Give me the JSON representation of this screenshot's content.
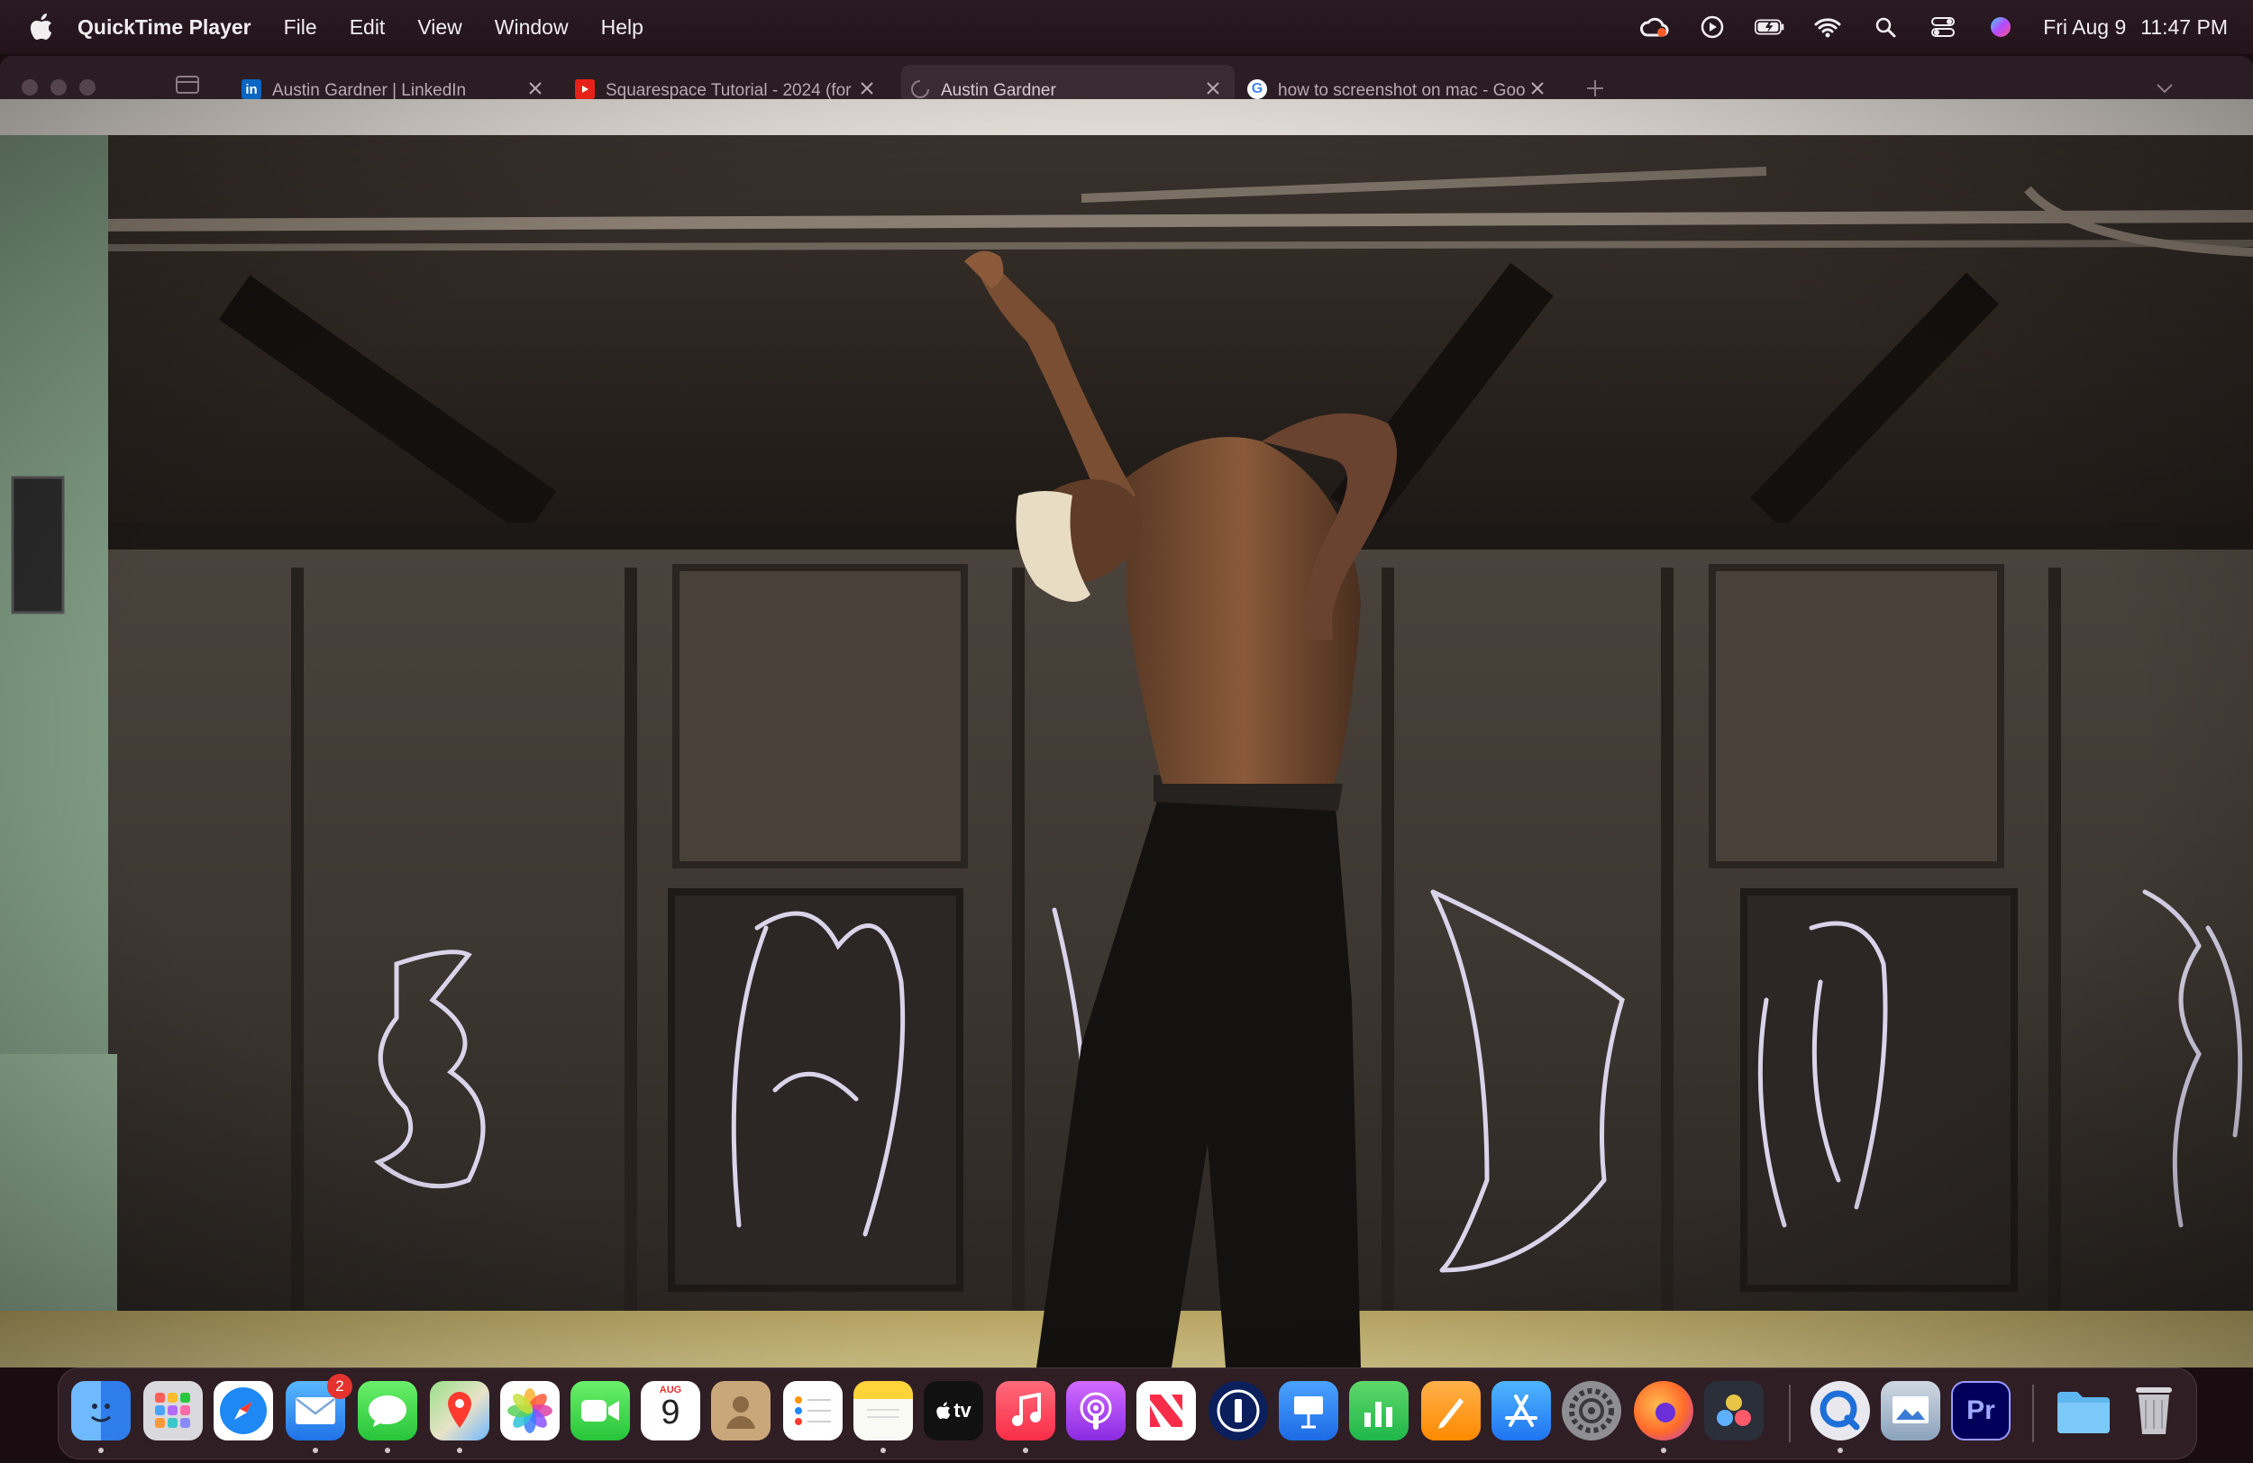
{
  "menubar": {
    "app_name": "QuickTime Player",
    "menus": [
      "File",
      "Edit",
      "View",
      "Window",
      "Help"
    ],
    "date": "Fri Aug 9",
    "time": "11:47 PM",
    "status_icons": [
      "creative-cloud-icon",
      "play-circle-icon",
      "battery-charging-icon",
      "wifi-icon",
      "spotlight-search-icon",
      "control-center-icon",
      "siri-icon"
    ]
  },
  "browser_tabs": [
    {
      "title": "Austin Gardner | LinkedIn",
      "favicon": "linkedin-icon",
      "active": false
    },
    {
      "title": "Squarespace Tutorial - 2024 (for",
      "favicon": "youtube-icon",
      "active": false
    },
    {
      "title": "Austin Gardner",
      "favicon": "loading-spinner-icon",
      "active": true
    },
    {
      "title": "how to screenshot on mac - Goo",
      "favicon": "google-icon",
      "active": false
    }
  ],
  "dock": {
    "mail_badge": "2",
    "calendar_month": "AUG",
    "calendar_day": "9",
    "tv_label": "tv",
    "premiere_label": "Pr",
    "apps": [
      "Finder",
      "Launchpad",
      "Safari",
      "Mail",
      "Messages",
      "Maps",
      "Photos",
      "FaceTime",
      "Calendar",
      "Contacts",
      "Reminders",
      "Notes",
      "TV",
      "Music",
      "Podcasts",
      "News",
      "1Password",
      "Keynote",
      "Numbers",
      "Pages",
      "App Store",
      "System Settings",
      "Firefox",
      "DaVinci Resolve",
      "QuickTime Player",
      "Preview",
      "Adobe Premiere Pro",
      "Downloads",
      "Trash"
    ]
  },
  "colors": {
    "menubar_bg": "#23141b",
    "accent_green_pillar": "#7f9a82",
    "platform_yellow": "#c9b46a"
  }
}
